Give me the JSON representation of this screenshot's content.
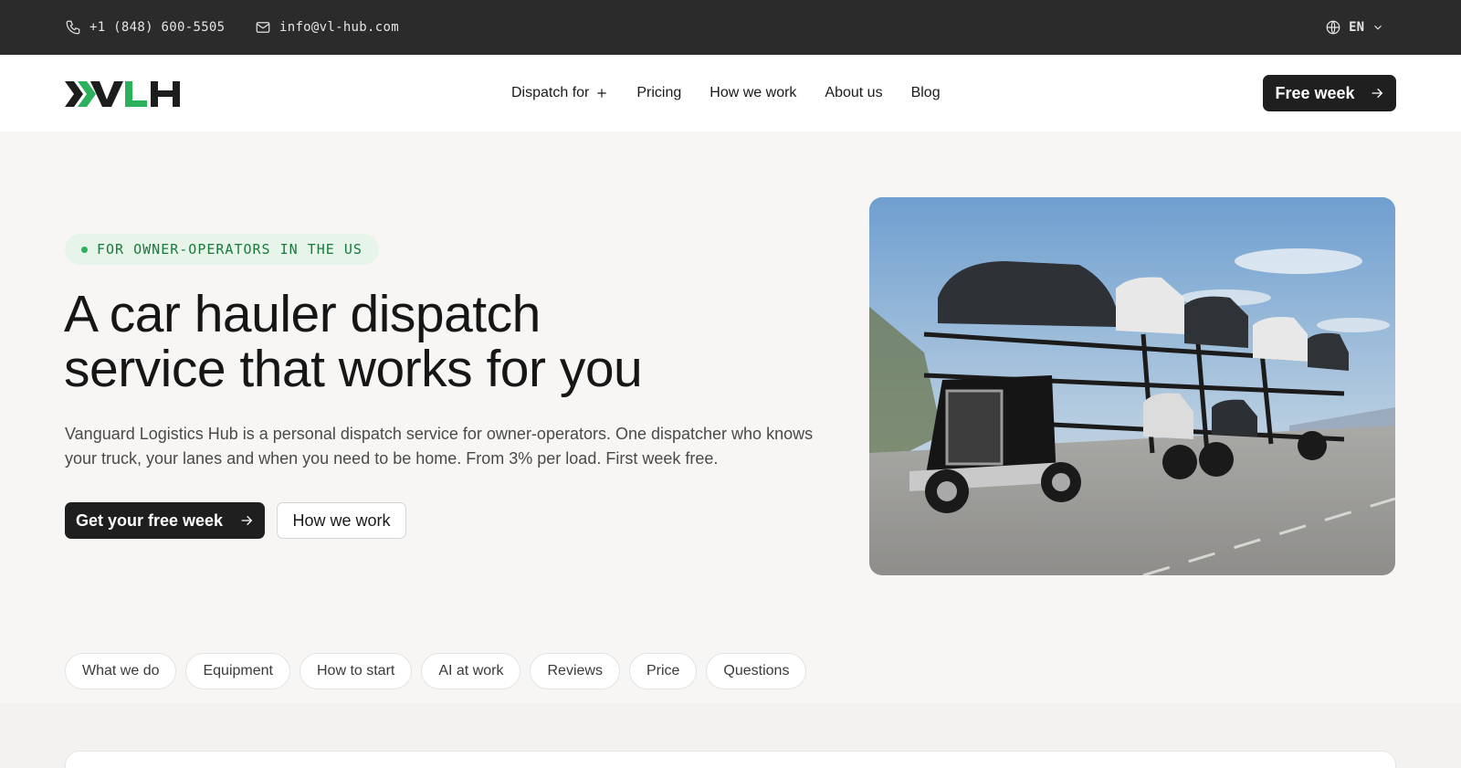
{
  "topbar": {
    "phone": "+1 (848) 600-5505",
    "email": "info@vl-hub.com",
    "language": "EN"
  },
  "header": {
    "logo_text": "VLH",
    "nav": [
      {
        "label": "Dispatch for",
        "icon": "plus-icon"
      },
      {
        "label": "Pricing"
      },
      {
        "label": "How we work"
      },
      {
        "label": "About us"
      },
      {
        "label": "Blog"
      }
    ],
    "cta_label": "Free week"
  },
  "hero": {
    "badge": "FOR OWNER-OPERATORS IN THE US",
    "title_line1": "A car hauler dispatch",
    "title_line2": "service that works for you",
    "description": "Vanguard Logistics Hub is a personal dispatch service for owner-operators. One dispatcher who knows your truck, your lanes and when you need to be home. From 3% per load. First week free.",
    "primary_button": "Get your free week",
    "secondary_button": "How we work"
  },
  "section_tabs": [
    "What we do",
    "Equipment",
    "How to start",
    "AI at work",
    "Reviews",
    "Price",
    "Questions"
  ],
  "colors": {
    "accent_green": "#2bb05c",
    "dark": "#1f1f1f",
    "topbar": "#2b2b2b",
    "background": "#f7f6f4"
  }
}
